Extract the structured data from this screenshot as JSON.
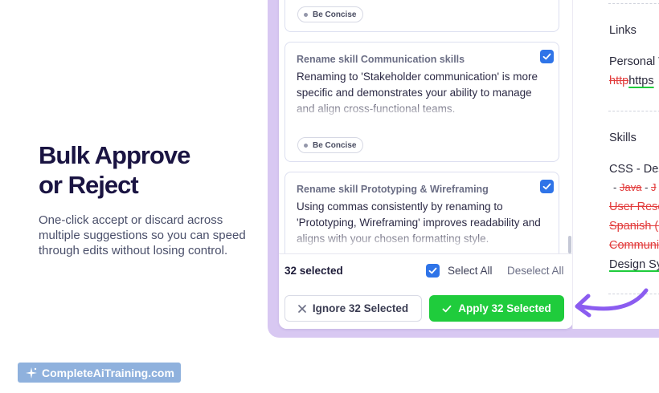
{
  "hero": {
    "headline_line1": "Bulk Approve",
    "headline_line2": "or Reject",
    "subcopy": "One-click accept or discard across multiple suggestions so you can speed through edits without losing control."
  },
  "brand": {
    "logo_text": "CompleteAiTraining.com"
  },
  "suggestions": [
    {
      "tag": "Be Concise"
    },
    {
      "title": "Rename skill Communication skills",
      "description": "Renaming to 'Stakeholder communication' is more specific and demonstrates your ability to manage and align cross-functional teams.",
      "tag": "Be Concise",
      "checked": true
    },
    {
      "title": "Rename skill Prototyping & Wireframing",
      "description": "Using commas consistently by renaming to 'Prototyping, Wireframing' improves readability and aligns with your chosen formatting style.",
      "checked": true
    }
  ],
  "footer": {
    "count_label": "32 selected",
    "select_all": "Select All",
    "deselect_all": "Deselect All",
    "ignore_label": "Ignore 32 Selected",
    "apply_label": "Apply 32 Selected"
  },
  "resume": {
    "links_heading": "Links",
    "personal_label": "Personal W",
    "link_removed": "http",
    "link_added": "https",
    "skills_heading": "Skills",
    "skill_css": "CSS",
    "sep": "-",
    "skill_des": "Des",
    "skill_java": "Java",
    "skill_j": "J",
    "skill_user_research": "User Rese",
    "skill_spanish": "Spanish (i",
    "skill_communication": "Communi",
    "skill_design_system": "Design Sy"
  },
  "colors": {
    "accent_blue": "#2f74e8",
    "apply_green": "#1fcc3c",
    "frame_purple": "#d8c8f2",
    "arrow_purple": "#8b5cf0",
    "removed_red": "#e23b3b"
  }
}
